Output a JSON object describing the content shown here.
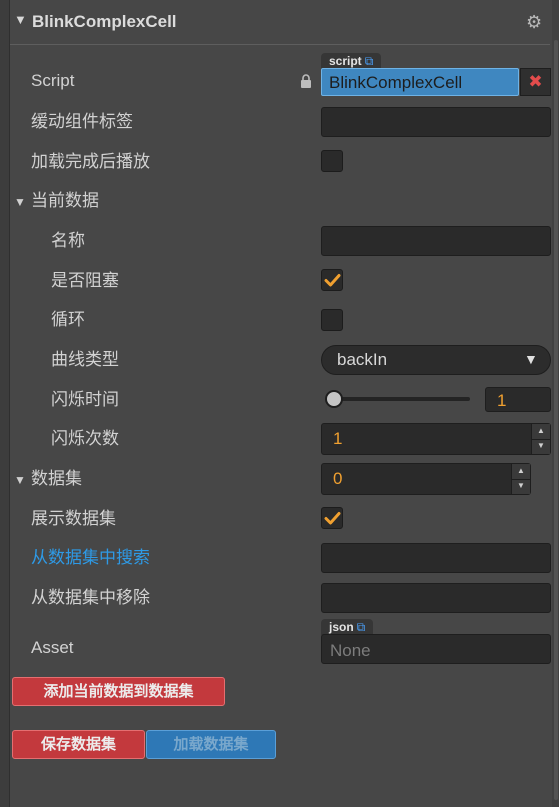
{
  "header": {
    "title": "BlinkComplexCell"
  },
  "script": {
    "label": "Script",
    "tag": "script",
    "value": "BlinkComplexCell",
    "clear": "✖"
  },
  "fields": {
    "cache_tag": "缓动组件标签",
    "autoplay": "加载完成后播放",
    "current_data": "当前数据",
    "name": "名称",
    "block": "是否阻塞",
    "loop": "循环",
    "curve_type": "曲线类型",
    "blink_time": "闪烁时间",
    "blink_count": "闪烁次数",
    "dataset": "数据集",
    "show_dataset": "展示数据集",
    "search_dataset": "从数据集中搜索",
    "remove_dataset": "从数据集中移除",
    "asset": "Asset"
  },
  "values": {
    "curve_type": "backIn",
    "blink_time": "1",
    "blink_time_progress": 0,
    "blink_count": "1",
    "dataset_count": "0",
    "autoplay_checked": false,
    "block_checked": true,
    "loop_checked": false,
    "show_dataset_checked": true
  },
  "asset": {
    "tag": "json",
    "value": "None"
  },
  "buttons": {
    "add_current": "添加当前数据到数据集",
    "save_dataset": "保存数据集",
    "load_dataset": "加载数据集"
  },
  "colors": {
    "accent_orange": "#f0a030",
    "link_blue": "#2e9ae6",
    "danger_red": "#c3393d",
    "primary_blue": "#2e78b6"
  }
}
